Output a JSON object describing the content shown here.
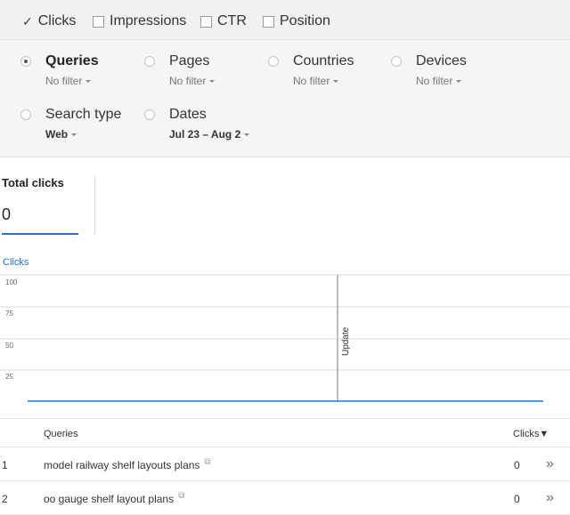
{
  "metrics": [
    {
      "label": "Clicks",
      "checked": true
    },
    {
      "label": "Impressions",
      "checked": false
    },
    {
      "label": "CTR",
      "checked": false
    },
    {
      "label": "Position",
      "checked": false
    }
  ],
  "filters": [
    {
      "title": "Queries",
      "value": "No filter",
      "selected": true
    },
    {
      "title": "Pages",
      "value": "No filter",
      "selected": false
    },
    {
      "title": "Countries",
      "value": "No filter",
      "selected": false
    },
    {
      "title": "Devices",
      "value": "No filter",
      "selected": false
    },
    {
      "title": "Search type",
      "value": "Web",
      "selected": false
    },
    {
      "title": "Dates",
      "value": "Jul 23 – Aug 2",
      "selected": false
    }
  ],
  "totals": {
    "label": "Total clicks",
    "value": "0"
  },
  "chart": {
    "title": "Clicks",
    "y_ticks": [
      "100",
      "75",
      "50",
      "25"
    ],
    "annotation": "Update",
    "line_color": "#1a73e8"
  },
  "chart_data": {
    "type": "line",
    "title": "Clicks",
    "ylim": [
      0,
      100
    ],
    "y_ticks": [
      100,
      75,
      50,
      25
    ],
    "series": [
      {
        "values": [
          0,
          0
        ]
      }
    ],
    "annotations": [
      "Update"
    ],
    "grid": true
  },
  "table": {
    "columns": [
      "Queries",
      "Clicks▼"
    ],
    "rows": [
      {
        "num": "1",
        "query": "model railway shelf layouts plans",
        "clicks": "0"
      },
      {
        "num": "2",
        "query": "oo gauge shelf layout plans",
        "clicks": "0"
      }
    ],
    "row_action_glyph": "»"
  },
  "icons": {
    "checkmark": "check-icon",
    "external": "external-link-icon",
    "row_action": "double-chevron-right-icon"
  }
}
